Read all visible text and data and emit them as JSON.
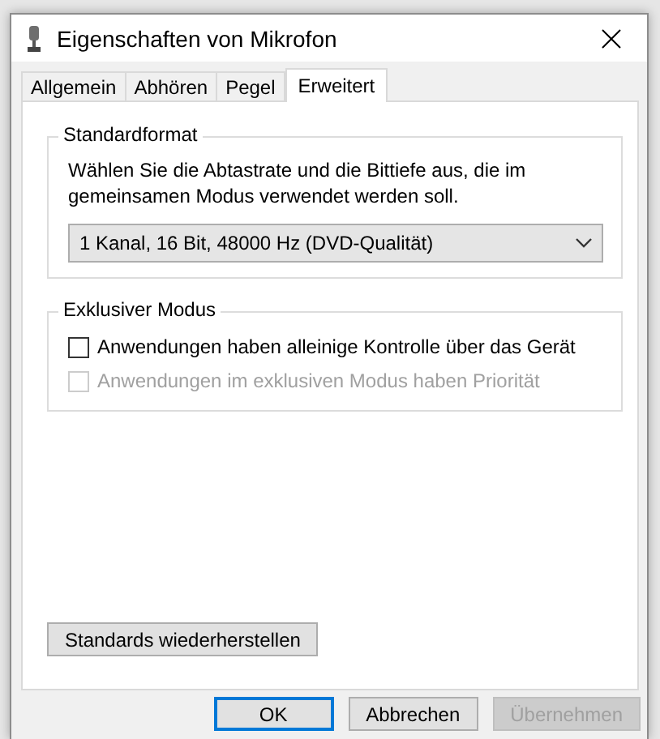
{
  "window": {
    "title": "Eigenschaften von Mikrofon"
  },
  "tabs": [
    {
      "label": "Allgemein",
      "selected": false
    },
    {
      "label": "Abhören",
      "selected": false
    },
    {
      "label": "Pegel",
      "selected": false
    },
    {
      "label": "Erweitert",
      "selected": true
    }
  ],
  "groups": [
    {
      "title": "Standardformat",
      "description": "Wählen Sie die Abtastrate und die Bittiefe aus, die im gemeinsamen Modus verwendet werden soll.",
      "dropdown": {
        "value": "1 Kanal, 16 Bit, 48000 Hz (DVD-Qualität)"
      }
    },
    {
      "title": "Exklusiver Modus",
      "options": [
        {
          "label": "Anwendungen haben alleinige Kontrolle über das Gerät",
          "checked": false,
          "disabled": false
        },
        {
          "label": "Anwendungen im exklusiven Modus haben Priorität",
          "checked": false,
          "disabled": true
        }
      ]
    }
  ],
  "restore_button": "Standards wiederherstellen",
  "buttons": [
    {
      "label": "OK",
      "default": true,
      "disabled": false
    },
    {
      "label": "Abbrechen",
      "default": false,
      "disabled": false
    },
    {
      "label": "Übernehmen",
      "default": false,
      "disabled": true
    }
  ]
}
